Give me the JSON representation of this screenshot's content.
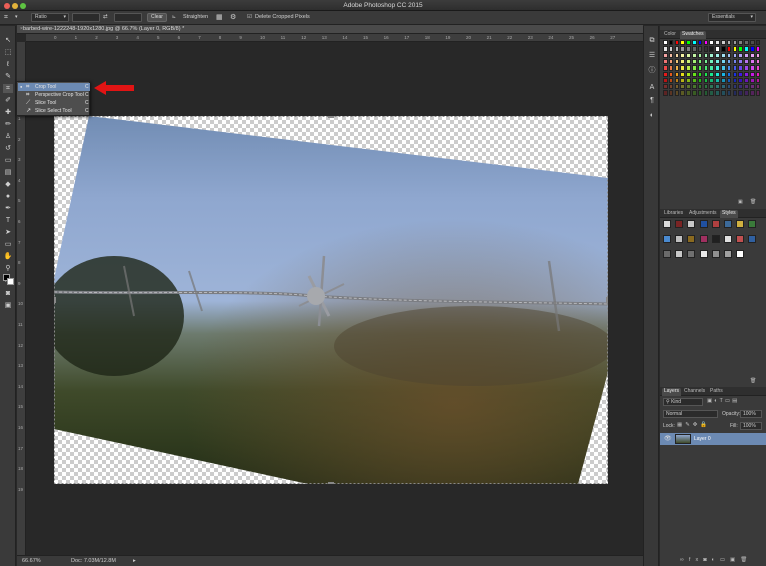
{
  "window": {
    "title": "Adobe Photoshop CC 2015"
  },
  "options_bar": {
    "ratio_label": "Ratio",
    "clear_label": "Clear",
    "straighten_label": "Straighten",
    "delete_cropped_label": "Delete Cropped Pixels",
    "workspace_label": "Essentials"
  },
  "document": {
    "tab_title": "barbed-wire-1222248-1920x1280.jpg @ 66.7% (Layer 0, RGB/8) *",
    "zoom": "66.67%",
    "doc_size": "Doc: 7.03M/12.8M"
  },
  "rulers": {
    "horizontal": [
      "0",
      "1",
      "2",
      "3",
      "4",
      "5",
      "6",
      "7",
      "8",
      "9",
      "10",
      "11",
      "12",
      "13",
      "14",
      "15",
      "16",
      "17",
      "18",
      "19",
      "20",
      "21",
      "22",
      "23",
      "24",
      "25",
      "26",
      "27"
    ],
    "vertical": [
      "1",
      "2",
      "3",
      "4",
      "5",
      "6",
      "7",
      "8",
      "9",
      "10",
      "11",
      "12",
      "13",
      "14",
      "15",
      "16",
      "17",
      "18",
      "19"
    ]
  },
  "flyout_menu": {
    "items": [
      {
        "label": "Crop Tool",
        "shortcut": "C"
      },
      {
        "label": "Perspective Crop Tool",
        "shortcut": "C"
      },
      {
        "label": "Slice Tool",
        "shortcut": "C"
      },
      {
        "label": "Slice Select Tool",
        "shortcut": "C"
      }
    ]
  },
  "panels": {
    "color_tabs": [
      "Color",
      "Swatches"
    ],
    "styles_tabs": [
      "Libraries",
      "Adjustments",
      "Styles"
    ],
    "layers_tabs": [
      "Layers",
      "Channels",
      "Paths"
    ],
    "kind_label": "Kind",
    "blend_mode": "Normal",
    "opacity_label": "Opacity:",
    "opacity_value": "100%",
    "lock_label": "Lock:",
    "fill_label": "Fill:",
    "fill_value": "100%",
    "layer_name": "Layer 0"
  },
  "colors": {
    "arrow": "#e11414",
    "selection": "#6c8ab3"
  }
}
